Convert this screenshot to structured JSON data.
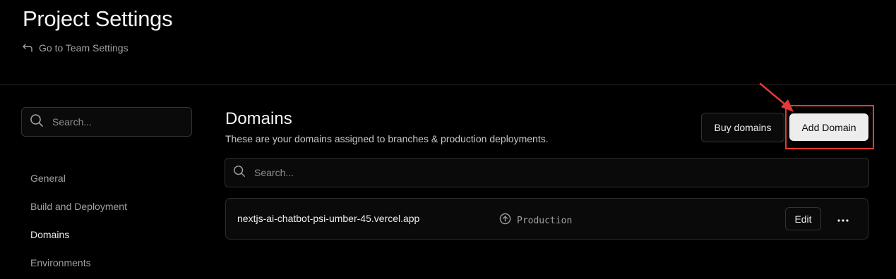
{
  "header": {
    "title": "Project Settings",
    "back_link": {
      "label": "Go to Team Settings",
      "icon": "arrow-return-left-icon"
    }
  },
  "sidebar": {
    "search": {
      "placeholder": "Search...",
      "icon": "search-icon"
    },
    "items": [
      {
        "label": "General",
        "active": false
      },
      {
        "label": "Build and Deployment",
        "active": false
      },
      {
        "label": "Domains",
        "active": true
      },
      {
        "label": "Environments",
        "active": false
      }
    ]
  },
  "main": {
    "title": "Domains",
    "description": "These are your domains assigned to branches & production deployments.",
    "buy_button": "Buy domains",
    "add_button": "Add Domain",
    "search": {
      "placeholder": "Search...",
      "icon": "search-icon"
    },
    "domains": [
      {
        "name": "nextjs-ai-chatbot-psi-umber-45.vercel.app",
        "environment": "Production",
        "environment_icon": "arrow-up-circle-icon",
        "edit_label": "Edit",
        "more_icon": "more-horizontal-icon"
      }
    ]
  },
  "annotation": {
    "color": "#e53935"
  },
  "colors": {
    "background": "#000000",
    "primary_button": "#ededed",
    "border": "#2e2e2e"
  }
}
